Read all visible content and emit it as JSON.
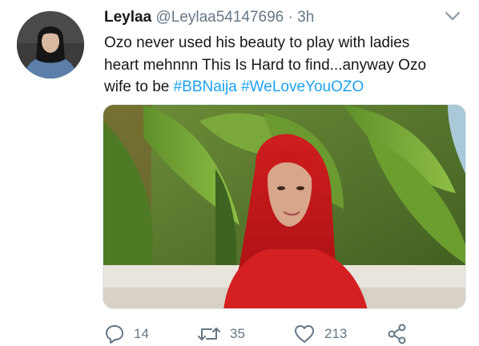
{
  "author": {
    "name": "Leylaa",
    "handle": "@Leylaa54147696",
    "separator": "·",
    "time": "3h"
  },
  "tweet": {
    "text": "Ozo never used his beauty to play with ladies heart mehnnn This Is Hard to find...anyway Ozo wife to be",
    "hashtags": [
      "#BBNaija",
      "#WeLoveYouOZO"
    ]
  },
  "actions": {
    "reply": {
      "icon": "reply-icon",
      "count": "14"
    },
    "retweet": {
      "icon": "retweet-icon",
      "count": "35"
    },
    "like": {
      "icon": "heart-icon",
      "count": "213"
    },
    "share": {
      "icon": "share-icon"
    }
  },
  "colors": {
    "hashtag": "#1da1f2",
    "muted": "#657786",
    "text": "#14171a"
  }
}
